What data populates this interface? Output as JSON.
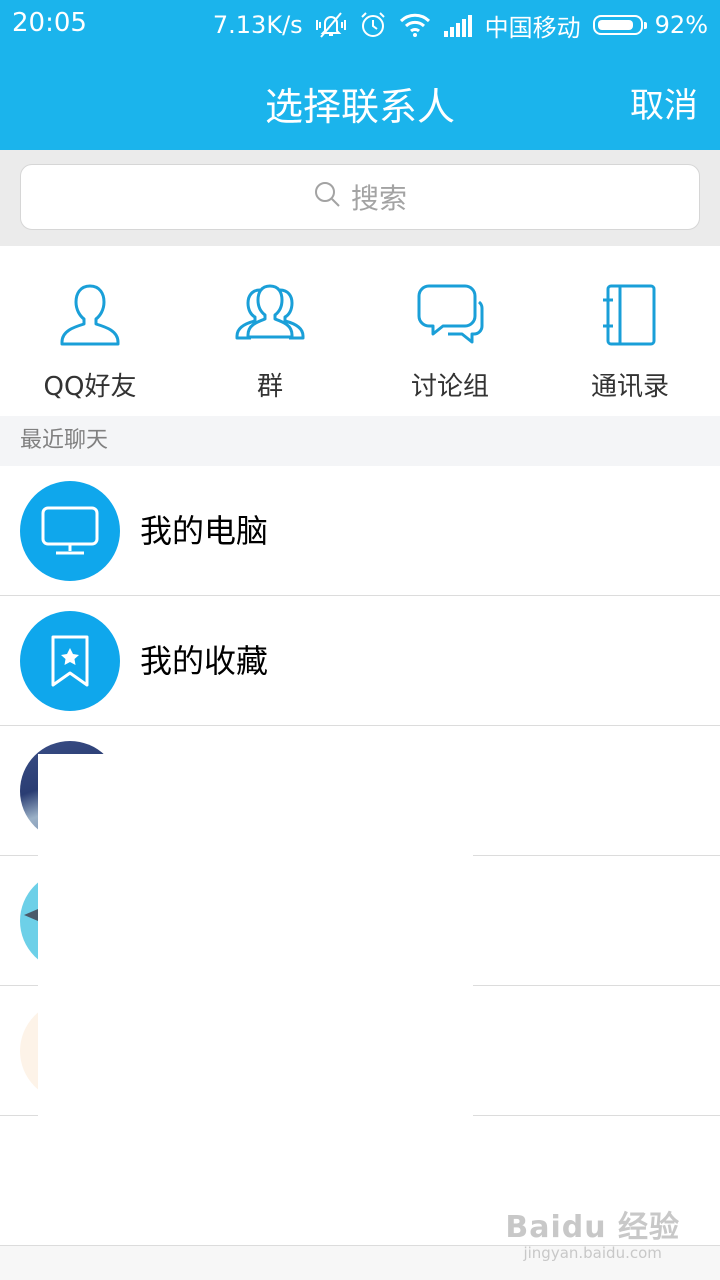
{
  "status_bar": {
    "time": "20:05",
    "speed": "7.13K/s",
    "carrier": "中国移动",
    "battery_text": "92%",
    "battery_level": 0.92,
    "icons": [
      "mute-vibrate-icon",
      "alarm-icon",
      "wifi-icon",
      "signal-icon",
      "battery-icon"
    ]
  },
  "header": {
    "title": "选择联系人",
    "cancel_label": "取消",
    "background_color": "#1bb4ec"
  },
  "search": {
    "placeholder": "搜索"
  },
  "categories": [
    {
      "label": "QQ好友",
      "icon": "person-icon"
    },
    {
      "label": "群",
      "icon": "group-icon"
    },
    {
      "label": "讨论组",
      "icon": "chat-bubbles-icon"
    },
    {
      "label": "通讯录",
      "icon": "address-book-icon"
    }
  ],
  "recent": {
    "section_label": "最近聊天",
    "items": [
      {
        "name": "我的电脑",
        "icon": "monitor-icon"
      },
      {
        "name": "我的收藏",
        "icon": "bookmark-star-icon"
      },
      {
        "name": "",
        "icon": "avatar-photo"
      },
      {
        "name": "",
        "icon": "avatar-photo"
      },
      {
        "name": "",
        "icon": "avatar-photo"
      }
    ]
  },
  "watermark": {
    "brand": "Baidu 经验",
    "url": "jingyan.baidu.com"
  },
  "colors": {
    "accent": "#1bb4ec",
    "icon_blue": "#1a9fd8",
    "avatar_blue": "#0fa7ec"
  }
}
